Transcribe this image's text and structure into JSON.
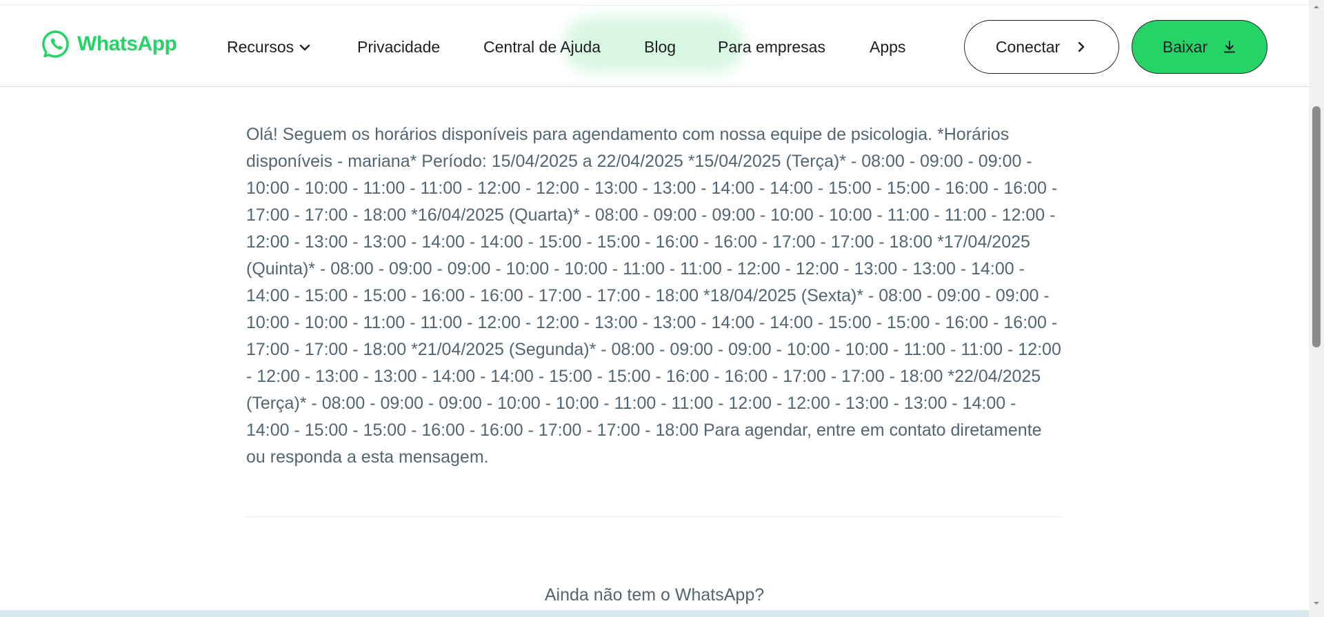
{
  "header": {
    "brand": "WhatsApp",
    "nav": [
      {
        "label": "Recursos",
        "has_dropdown": true
      },
      {
        "label": "Privacidade"
      },
      {
        "label": "Central de Ajuda"
      },
      {
        "label": "Blog"
      },
      {
        "label": "Para empresas"
      },
      {
        "label": "Apps"
      }
    ],
    "connect_label": "Conectar",
    "download_label": "Baixar"
  },
  "message": {
    "text": "Olá! Seguem os horários disponíveis para agendamento com nossa equipe de psicologia. *Horários disponíveis - mariana* Período: 15/04/2025 a 22/04/2025 *15/04/2025 (Terça)* - 08:00 - 09:00 - 09:00 - 10:00 - 10:00 - 11:00 - 11:00 - 12:00 - 12:00 - 13:00 - 13:00 - 14:00 - 14:00 - 15:00 - 15:00 - 16:00 - 16:00 - 17:00 - 17:00 - 18:00 *16/04/2025 (Quarta)* - 08:00 - 09:00 - 09:00 - 10:00 - 10:00 - 11:00 - 11:00 - 12:00 - 12:00 - 13:00 - 13:00 - 14:00 - 14:00 - 15:00 - 15:00 - 16:00 - 16:00 - 17:00 - 17:00 - 18:00 *17/04/2025 (Quinta)* - 08:00 - 09:00 - 09:00 - 10:00 - 10:00 - 11:00 - 11:00 - 12:00 - 12:00 - 13:00 - 13:00 - 14:00 - 14:00 - 15:00 - 15:00 - 16:00 - 16:00 - 17:00 - 17:00 - 18:00 *18/04/2025 (Sexta)* - 08:00 - 09:00 - 09:00 - 10:00 - 10:00 - 11:00 - 11:00 - 12:00 - 12:00 - 13:00 - 13:00 - 14:00 - 14:00 - 15:00 - 15:00 - 16:00 - 16:00 - 17:00 - 17:00 - 18:00 *21/04/2025 (Segunda)* - 08:00 - 09:00 - 09:00 - 10:00 - 10:00 - 11:00 - 11:00 - 12:00 - 12:00 - 13:00 - 13:00 - 14:00 - 14:00 - 15:00 - 15:00 - 16:00 - 16:00 - 17:00 - 17:00 - 18:00 *22/04/2025 (Terça)* - 08:00 - 09:00 - 09:00 - 10:00 - 10:00 - 11:00 - 11:00 - 12:00 - 12:00 - 13:00 - 13:00 - 14:00 - 14:00 - 15:00 - 15:00 - 16:00 - 16:00 - 17:00 - 17:00 - 18:00 Para agendar, entre em contato diretamente ou responda a esta mensagem."
  },
  "cta": {
    "text": "Ainda não tem o WhatsApp?"
  },
  "colors": {
    "brand_green": "#25d366",
    "text_gray": "#54656f",
    "dark": "#1c1e21"
  },
  "icons": {
    "logo": "whatsapp-logo-icon",
    "dropdown": "chevron-down-icon",
    "connect": "chevron-right-icon",
    "download": "download-icon"
  }
}
